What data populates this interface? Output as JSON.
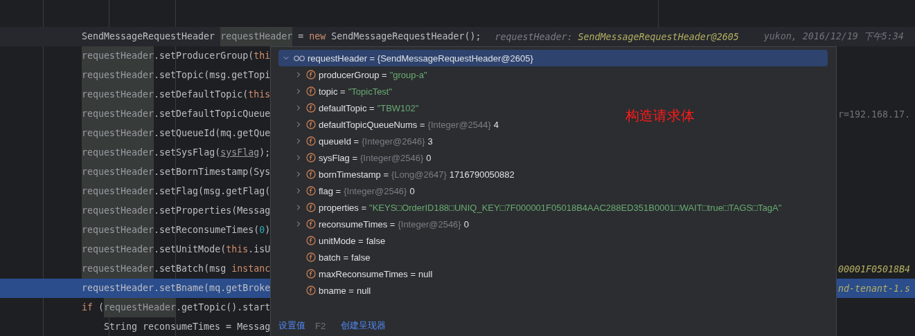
{
  "editor": {
    "lines": [
      {
        "current": true,
        "selected": false,
        "code": [
          {
            "kind": "plain",
            "text": "SendMessageRequestHeader "
          },
          {
            "kind": "usage",
            "text": "requestHeader"
          },
          {
            "kind": "plain",
            "text": " = "
          },
          {
            "kind": "keyword",
            "text": "new"
          },
          {
            "kind": "plain",
            "text": " SendMessageRequestHeader();"
          }
        ],
        "inlay": {
          "label": "requestHeader:",
          "value": "SendMessageRequestHeader@2605"
        },
        "blame": "yukon, 2016/12/19 下午5:34"
      },
      {
        "current": false,
        "selected": false,
        "code": [
          {
            "kind": "usage",
            "text": "requestHeader"
          },
          {
            "kind": "plain",
            "text": ".setProducerGroup("
          },
          {
            "kind": "keyword",
            "text": "thi"
          }
        ]
      },
      {
        "current": false,
        "selected": false,
        "code": [
          {
            "kind": "usage",
            "text": "requestHeader"
          },
          {
            "kind": "plain",
            "text": ".setTopic(msg.getTopi"
          }
        ]
      },
      {
        "current": false,
        "selected": false,
        "code": [
          {
            "kind": "usage",
            "text": "requestHeader"
          },
          {
            "kind": "plain",
            "text": ".setDefaultTopic("
          },
          {
            "kind": "keyword",
            "text": "this"
          }
        ]
      },
      {
        "current": false,
        "selected": false,
        "code": [
          {
            "kind": "usage",
            "text": "requestHeader"
          },
          {
            "kind": "plain",
            "text": ".setDefaultTopicQueue"
          }
        ],
        "tail": {
          "kind": "plain",
          "text": "r=192.168.17."
        }
      },
      {
        "current": false,
        "selected": false,
        "code": [
          {
            "kind": "usage",
            "text": "requestHeader"
          },
          {
            "kind": "plain",
            "text": ".setQueueId(mq.getQue"
          }
        ]
      },
      {
        "current": false,
        "selected": false,
        "code": [
          {
            "kind": "usage",
            "text": "requestHeader"
          },
          {
            "kind": "plain",
            "text": ".setSysFlag("
          },
          {
            "kind": "underline",
            "text": "sysFlag"
          },
          {
            "kind": "plain",
            "text": ");"
          }
        ]
      },
      {
        "current": false,
        "selected": false,
        "code": [
          {
            "kind": "usage",
            "text": "requestHeader"
          },
          {
            "kind": "plain",
            "text": ".setBornTimestamp(Sys"
          }
        ]
      },
      {
        "current": false,
        "selected": false,
        "code": [
          {
            "kind": "usage",
            "text": "requestHeader"
          },
          {
            "kind": "plain",
            "text": ".setFlag(msg.getFlag("
          }
        ]
      },
      {
        "current": false,
        "selected": false,
        "code": [
          {
            "kind": "usage",
            "text": "requestHeader"
          },
          {
            "kind": "plain",
            "text": ".setProperties(Messag"
          }
        ]
      },
      {
        "current": false,
        "selected": false,
        "code": [
          {
            "kind": "usage",
            "text": "requestHeader"
          },
          {
            "kind": "plain",
            "text": ".setReconsumeTimes("
          },
          {
            "kind": "number",
            "text": "0"
          },
          {
            "kind": "plain",
            "text": ")"
          }
        ]
      },
      {
        "current": false,
        "selected": false,
        "code": [
          {
            "kind": "usage",
            "text": "requestHeader"
          },
          {
            "kind": "plain",
            "text": ".setUnitMode("
          },
          {
            "kind": "keyword",
            "text": "this"
          },
          {
            "kind": "plain",
            "text": ".isU"
          }
        ]
      },
      {
        "current": false,
        "selected": false,
        "code": [
          {
            "kind": "usage",
            "text": "requestHeader"
          },
          {
            "kind": "plain",
            "text": ".setBatch(msg "
          },
          {
            "kind": "keyword",
            "text": "instanc"
          }
        ],
        "tail": {
          "kind": "hint",
          "text": "00001F05018B4"
        }
      },
      {
        "current": false,
        "selected": true,
        "code": [
          {
            "kind": "plain",
            "text": "requestHeader.setBname(mq.getBroke"
          }
        ],
        "tail": {
          "kind": "hint",
          "text": "nd-tenant-1.s"
        }
      },
      {
        "current": false,
        "selected": false,
        "code": [
          {
            "kind": "keyword",
            "text": "if"
          },
          {
            "kind": "plain",
            "text": " ("
          },
          {
            "kind": "usage",
            "text": "requestHeader"
          },
          {
            "kind": "plain",
            "text": ".getTopic().start"
          }
        ],
        "children": [
          {
            "current": false,
            "selected": false,
            "code": [
              {
                "kind": "plain",
                "text": "String reconsumeTimes = Messag"
              }
            ]
          }
        ]
      }
    ]
  },
  "debugger_popup": {
    "root": {
      "text": "requestHeader = {SendMessageRequestHeader@2605}",
      "expanded": true,
      "selected": true
    },
    "fields": [
      {
        "name": "producerGroup =",
        "value": "\"group-a\"",
        "kind": "string",
        "expandable": true
      },
      {
        "name": "topic =",
        "value": "\"TopicTest\"",
        "kind": "string",
        "expandable": true
      },
      {
        "name": "defaultTopic =",
        "value": "\"TBW102\"",
        "kind": "string",
        "expandable": true
      },
      {
        "name": "defaultTopicQueueNums =",
        "ref": "{Integer@2544}",
        "value": "4",
        "kind": "plain",
        "expandable": true
      },
      {
        "name": "queueId =",
        "ref": "{Integer@2646}",
        "value": "3",
        "kind": "plain",
        "expandable": true
      },
      {
        "name": "sysFlag =",
        "ref": "{Integer@2546}",
        "value": "0",
        "kind": "plain",
        "expandable": true
      },
      {
        "name": "bornTimestamp =",
        "ref": "{Long@2647}",
        "value": "1716790050882",
        "kind": "plain",
        "expandable": true
      },
      {
        "name": "flag =",
        "ref": "{Integer@2546}",
        "value": "0",
        "kind": "plain",
        "expandable": true
      },
      {
        "name": "properties =",
        "value": "\"KEYS□OrderID188□UNIQ_KEY□7F000001F05018B4AAC288ED351B0001□WAIT□true□TAGS□TagA\"",
        "kind": "string",
        "expandable": true
      },
      {
        "name": "reconsumeTimes =",
        "ref": "{Integer@2546}",
        "value": "0",
        "kind": "plain",
        "expandable": true
      },
      {
        "name": "unitMode =",
        "value": "false",
        "kind": "plain",
        "expandable": false
      },
      {
        "name": "batch =",
        "value": "false",
        "kind": "plain",
        "expandable": false
      },
      {
        "name": "maxReconsumeTimes =",
        "value": "null",
        "kind": "plain",
        "expandable": false
      },
      {
        "name": "bname =",
        "value": "null",
        "kind": "plain",
        "expandable": false
      }
    ],
    "annotation": "构造请求体",
    "footer": [
      {
        "label": "设置值",
        "shortcut": "F2"
      },
      {
        "label": "创建呈现器"
      }
    ]
  }
}
